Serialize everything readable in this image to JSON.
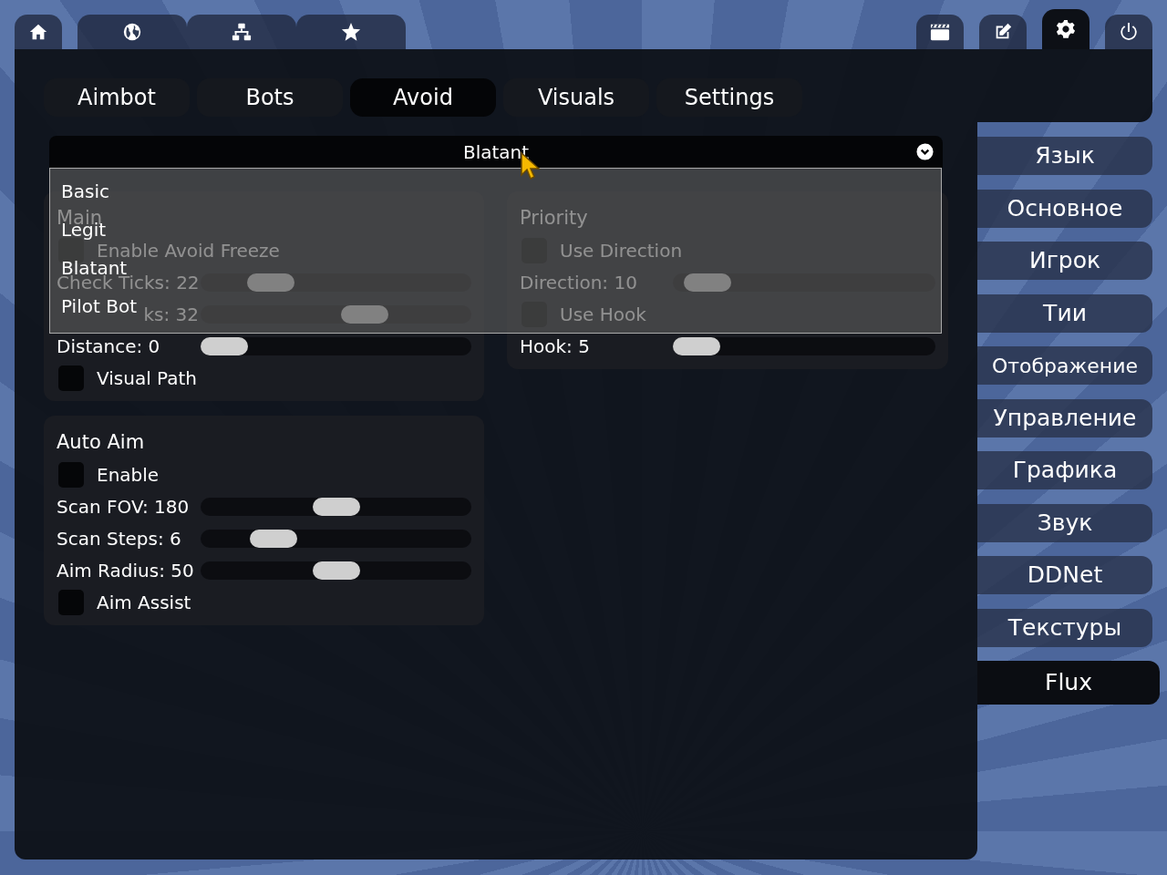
{
  "top_tabs_left": [
    {
      "selected": false
    },
    {
      "selected": false
    },
    {
      "selected": false
    },
    {
      "selected": false
    }
  ],
  "top_tabs_right": [
    {
      "selected": false
    },
    {
      "selected": false
    },
    {
      "selected": true
    },
    {
      "selected": false
    }
  ],
  "sub_tabs": [
    {
      "label": "Aimbot",
      "selected": false
    },
    {
      "label": "Bots",
      "selected": false
    },
    {
      "label": "Avoid",
      "selected": true
    },
    {
      "label": "Visuals",
      "selected": false
    },
    {
      "label": "Settings",
      "selected": false
    }
  ],
  "preset_dropdown": {
    "value": "Blatant",
    "expanded": true,
    "options": [
      "Basic",
      "Legit",
      "Blatant",
      "Pilot Bot"
    ]
  },
  "panels": [
    {
      "title": "Main",
      "rows": [
        {
          "kind": "checkbox",
          "label": "Enable Avoid Freeze",
          "checked": false
        },
        {
          "kind": "slider",
          "label": "Check Ticks: 22",
          "level": 0.21
        },
        {
          "kind": "slider",
          "label": "ks: 32",
          "level": 0.63,
          "covered": true
        },
        {
          "kind": "slider",
          "label": "Distance: 0",
          "level": 0
        },
        {
          "kind": "checkbox",
          "label": "Visual Path",
          "checked": false
        }
      ]
    },
    {
      "title": "Priority",
      "rows": [
        {
          "kind": "checkbox",
          "label": "Use Direction",
          "checked": false
        },
        {
          "kind": "slider",
          "label": "Direction: 10",
          "level": 0.05
        },
        {
          "kind": "checkbox",
          "label": "Use Hook",
          "checked": false
        },
        {
          "kind": "slider",
          "label": "Hook: 5",
          "level": 0
        }
      ]
    },
    {
      "title": "Auto Aim",
      "rows": [
        {
          "kind": "checkbox",
          "label": "Enable",
          "checked": false
        },
        {
          "kind": "slider",
          "label": "Scan FOV: 180",
          "level": 0.5
        },
        {
          "kind": "slider",
          "label": "Scan Steps: 6",
          "level": 0.22
        },
        {
          "kind": "slider",
          "label": "Aim Radius: 50",
          "level": 0.5
        },
        {
          "kind": "checkbox",
          "label": "Aim Assist",
          "checked": false
        }
      ]
    }
  ],
  "sidebar": [
    {
      "label": "Язык",
      "selected": false
    },
    {
      "label": "Основное",
      "selected": false
    },
    {
      "label": "Игрок",
      "selected": false
    },
    {
      "label": "Тии",
      "selected": false
    },
    {
      "label": "Отображение",
      "selected": false
    },
    {
      "label": "Управление",
      "selected": false
    },
    {
      "label": "Графика",
      "selected": false
    },
    {
      "label": "Звук",
      "selected": false
    },
    {
      "label": "DDNet",
      "selected": false
    },
    {
      "label": "Текстуры",
      "selected": false
    },
    {
      "label": "Flux",
      "selected": true
    }
  ]
}
